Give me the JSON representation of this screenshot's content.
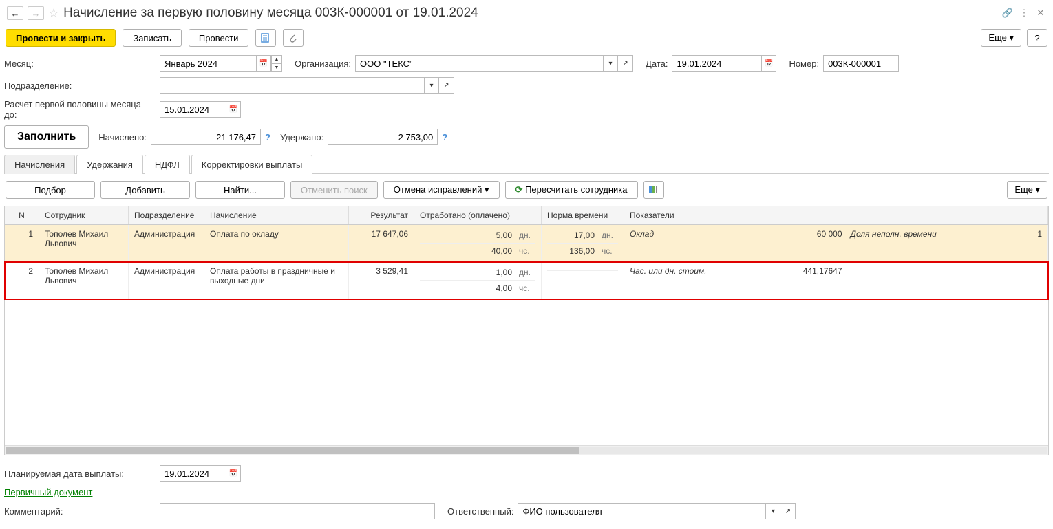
{
  "title": "Начисление за первую половину месяца 003К-000001 от 19.01.2024",
  "toolbar": {
    "post_close": "Провести и закрыть",
    "save": "Записать",
    "post": "Провести",
    "more": "Еще",
    "help": "?"
  },
  "form": {
    "month_label": "Месяц:",
    "month_value": "Январь 2024",
    "org_label": "Организация:",
    "org_value": "ООО \"ТЕКС\"",
    "date_label": "Дата:",
    "date_value": "19.01.2024",
    "number_label": "Номер:",
    "number_value": "003К-000001",
    "dept_label": "Подразделение:",
    "dept_value": "",
    "calc_until_label": "Расчет первой половины месяца до:",
    "calc_until_value": "15.01.2024",
    "fill": "Заполнить",
    "accrued_label": "Начислено:",
    "accrued_value": "21 176,47",
    "withheld_label": "Удержано:",
    "withheld_value": "2 753,00"
  },
  "tabs": {
    "t1": "Начисления",
    "t2": "Удержания",
    "t3": "НДФЛ",
    "t4": "Корректировки выплаты"
  },
  "tabbar": {
    "pick": "Подбор",
    "add": "Добавить",
    "find": "Найти...",
    "cancel_search": "Отменить поиск",
    "cancel_fix": "Отмена исправлений",
    "recalc": "Пересчитать сотрудника",
    "more": "Еще"
  },
  "grid": {
    "headers": {
      "n": "N",
      "emp": "Сотрудник",
      "dept": "Подразделение",
      "calc": "Начисление",
      "res": "Результат",
      "work": "Отработано (оплачено)",
      "norm": "Норма времени",
      "ind": "Показатели"
    },
    "rows": [
      {
        "n": "1",
        "emp": "Тополев Михаил Львович",
        "dept": "Администрация",
        "calc": "Оплата по окладу",
        "res": "17 647,06",
        "work_d": "5,00",
        "work_d_u": "дн.",
        "work_h": "40,00",
        "work_h_u": "чс.",
        "norm_d": "17,00",
        "norm_d_u": "дн.",
        "norm_h": "136,00",
        "norm_h_u": "чс.",
        "ind1": "Оклад",
        "ind1_val": "60 000",
        "ind2": "Доля неполн. времени",
        "ind2_val": "1"
      },
      {
        "n": "2",
        "emp": "Тополев Михаил Львович",
        "dept": "Администрация",
        "calc": "Оплата работы в праздничные и выходные дни",
        "res": "3 529,41",
        "work_d": "1,00",
        "work_d_u": "дн.",
        "work_h": "4,00",
        "work_h_u": "чс.",
        "norm_d": "",
        "norm_d_u": "",
        "norm_h": "",
        "norm_h_u": "",
        "ind1": "Час. или дн. стоим.",
        "ind1_val": "441,17647",
        "ind2": "",
        "ind2_val": ""
      }
    ]
  },
  "footer": {
    "plan_date_label": "Планируемая дата выплаты:",
    "plan_date_value": "19.01.2024",
    "primary_doc": "Первичный документ",
    "comment_label": "Комментарий:",
    "comment_value": "",
    "responsible_label": "Ответственный:",
    "responsible_value": "ФИО пользователя"
  }
}
